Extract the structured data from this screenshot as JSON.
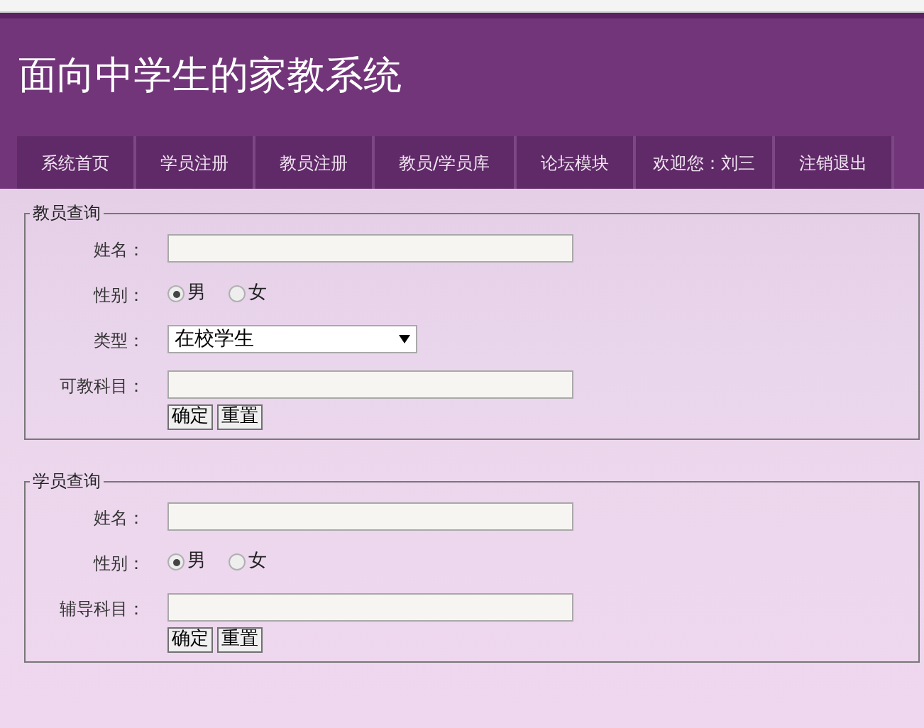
{
  "header": {
    "title": "面向中学生的家教系统"
  },
  "nav": [
    {
      "label": "系统首页",
      "kind": "link"
    },
    {
      "label": "学员注册",
      "kind": "link"
    },
    {
      "label": "教员注册",
      "kind": "link"
    },
    {
      "label": "教员/学员库",
      "kind": "link"
    },
    {
      "label": "论坛模块",
      "kind": "link"
    },
    {
      "label": "欢迎您：刘三",
      "kind": "text"
    },
    {
      "label": "注销退出",
      "kind": "link"
    }
  ],
  "forms": [
    {
      "legend": "教员查询",
      "fields": [
        {
          "kind": "text",
          "label": "姓名："
        },
        {
          "kind": "radio",
          "label": "性别：",
          "options": [
            {
              "label": "男",
              "selected": true
            },
            {
              "label": "女",
              "selected": false
            }
          ]
        },
        {
          "kind": "select",
          "label": "类型：",
          "value": "在校学生"
        },
        {
          "kind": "text",
          "label": "可教科目："
        }
      ],
      "buttons": [
        "确定",
        "重置"
      ]
    },
    {
      "legend": "学员查询",
      "fields": [
        {
          "kind": "text",
          "label": "姓名："
        },
        {
          "kind": "radio",
          "label": "性别：",
          "options": [
            {
              "label": "男",
              "selected": true
            },
            {
              "label": "女",
              "selected": false
            }
          ]
        },
        {
          "kind": "text",
          "label": "辅导科目："
        }
      ],
      "buttons": [
        "确定",
        "重置"
      ]
    }
  ]
}
